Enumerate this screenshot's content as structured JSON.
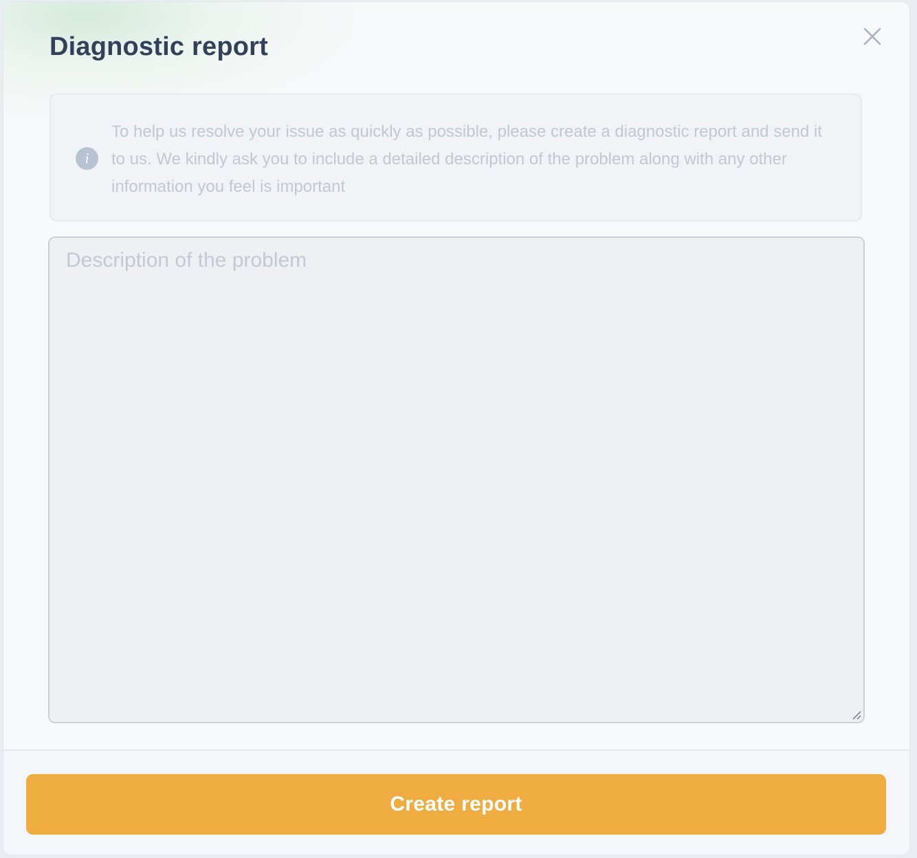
{
  "dialog": {
    "title": "Diagnostic report",
    "close_icon": "close-icon",
    "info": {
      "icon": "info-icon",
      "icon_glyph": "i",
      "text": "To help us resolve your issue as quickly as possible, please create a diagnostic report and send it to us. We kindly ask you to include a detailed description of the problem along with any other information you feel is important"
    },
    "description": {
      "placeholder": "Description of the problem",
      "value": ""
    },
    "footer": {
      "create_label": "Create report"
    }
  },
  "colors": {
    "title": "#33405a",
    "accent_button": "#efac40",
    "info_icon": "#b8c2d2",
    "muted_text": "#c1c8d3"
  }
}
